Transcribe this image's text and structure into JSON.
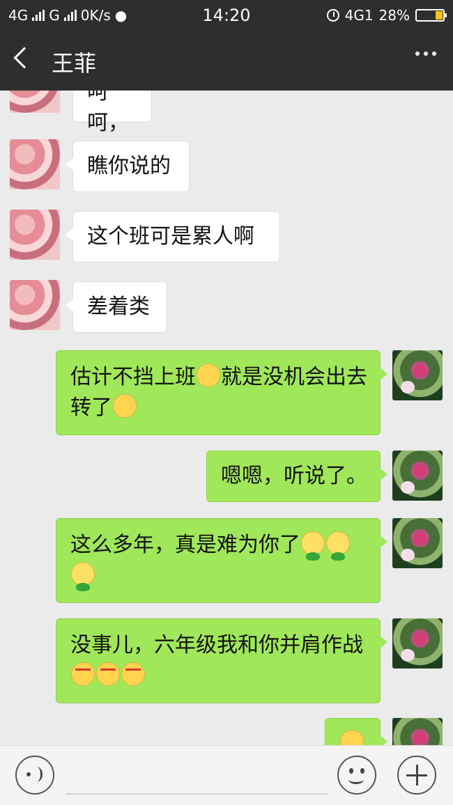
{
  "status_bar": {
    "network1": "4G",
    "network2": "G",
    "speed": "0K/s",
    "time": "14:20",
    "right_network": "4G1",
    "battery_percent_label": "28%",
    "battery_level": 0.28,
    "battery_fill_color": "#ffc21a"
  },
  "header": {
    "title": "王菲",
    "back_icon": "back-arrow-icon",
    "menu_icon": "more-icon"
  },
  "messages": [
    {
      "side": "in",
      "text": "呵呵，"
    },
    {
      "side": "in",
      "text": "瞧你说的"
    },
    {
      "side": "in",
      "text": "这个班可是累人啊"
    },
    {
      "side": "in",
      "text": "差着类"
    },
    {
      "side": "out",
      "text": "估计不挡上班",
      "emoji_mid": "thinking-emoji",
      "text2": "就是没机会出去转了",
      "emoji_end": "sad-emoji"
    },
    {
      "side": "out",
      "text": "嗯嗯，听说了。"
    },
    {
      "side": "out",
      "text": "这么多年，真是难为你了",
      "emojis": [
        "frog-emoji",
        "frog-emoji",
        "frog-emoji"
      ]
    },
    {
      "side": "out",
      "text": "没事儿，六年级我和你并肩作战",
      "emojis": [
        "angry-emoji",
        "angry-emoji",
        "angry-emoji"
      ]
    },
    {
      "side": "out",
      "text": "",
      "emojis": [
        "smile-emoji"
      ]
    }
  ],
  "input_bar": {
    "voice_icon": "voice-icon",
    "emoji_icon": "emoji-icon",
    "plus_icon": "plus-icon"
  },
  "colors": {
    "header_bg": "#2e2e2e",
    "chat_bg": "#ebebeb",
    "outgoing_bubble": "#a0e75a",
    "incoming_bubble": "#ffffff"
  }
}
